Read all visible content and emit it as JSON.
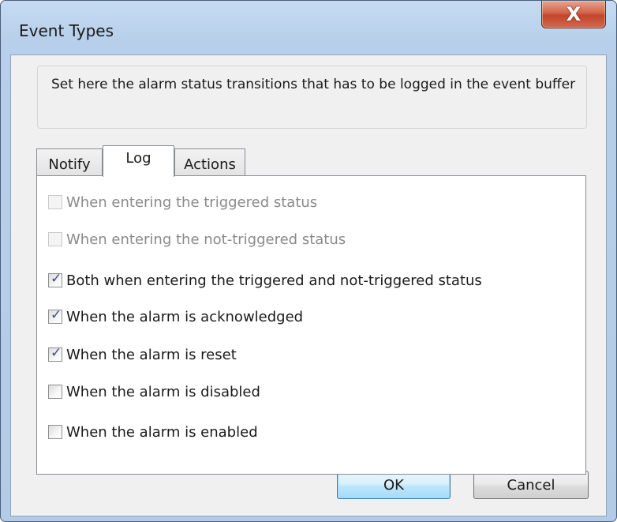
{
  "window": {
    "title": "Event Types",
    "close_glyph": "X"
  },
  "info": {
    "text": "Set here the alarm status transitions that has to be logged in the event buffer"
  },
  "tabs": [
    {
      "label": "Notify",
      "active": false
    },
    {
      "label": "Log",
      "active": true
    },
    {
      "label": "Actions",
      "active": false
    }
  ],
  "checkboxes": [
    {
      "label": "When entering the triggered status",
      "checked": false,
      "enabled": false
    },
    {
      "label": "When entering the not-triggered status",
      "checked": false,
      "enabled": false
    },
    {
      "label": "Both when entering the triggered and not-triggered status",
      "checked": true,
      "enabled": true
    },
    {
      "label": "When the alarm is acknowledged",
      "checked": true,
      "enabled": true
    },
    {
      "label": "When the alarm is reset",
      "checked": true,
      "enabled": true
    },
    {
      "label": "When the alarm is disabled",
      "checked": false,
      "enabled": true
    },
    {
      "label": "When the alarm is enabled",
      "checked": false,
      "enabled": true
    }
  ],
  "buttons": {
    "ok": "OK",
    "cancel": "Cancel"
  },
  "icons": {
    "close": "close-icon",
    "check": "check-icon"
  },
  "colors": {
    "title_bar": "#b9d1ea",
    "close_button": "#c7503a",
    "client": "#f0f0f0",
    "default_button_border": "#3c7fb1",
    "disabled_text": "#8a8a8a"
  }
}
